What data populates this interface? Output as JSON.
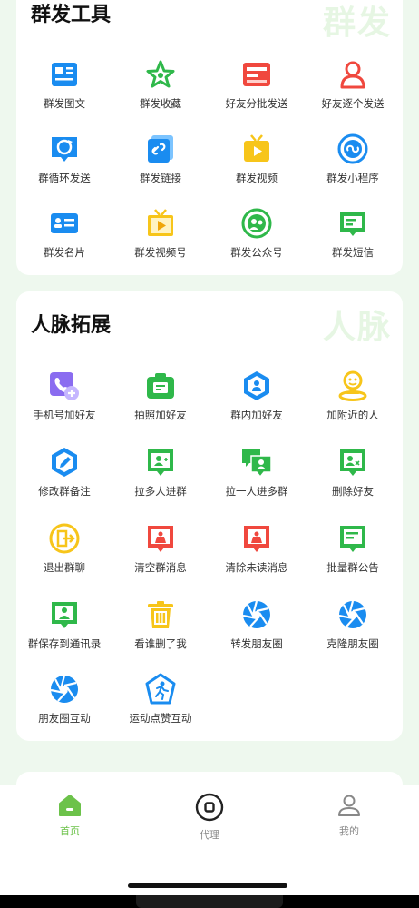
{
  "sections": [
    {
      "title": "群发工具",
      "watermark": "群发",
      "items": [
        {
          "label": "群发图文",
          "icon": "image-text-icon"
        },
        {
          "label": "群发收藏",
          "icon": "star-icon"
        },
        {
          "label": "好友分批发送",
          "icon": "batch-send-icon"
        },
        {
          "label": "好友逐个发送",
          "icon": "person-outline-icon"
        },
        {
          "label": "群循环发送",
          "icon": "cycle-chat-icon"
        },
        {
          "label": "群发链接",
          "icon": "link-icon"
        },
        {
          "label": "群发视频",
          "icon": "video-icon"
        },
        {
          "label": "群发小程序",
          "icon": "mini-program-icon"
        },
        {
          "label": "群发名片",
          "icon": "business-card-icon"
        },
        {
          "label": "群发视频号",
          "icon": "tv-icon"
        },
        {
          "label": "群发公众号",
          "icon": "official-account-icon"
        },
        {
          "label": "群发短信",
          "icon": "sms-icon"
        }
      ]
    },
    {
      "title": "人脉拓展",
      "watermark": "人脉",
      "items": [
        {
          "label": "手机号加好友",
          "icon": "phone-add-icon"
        },
        {
          "label": "拍照加好友",
          "icon": "camera-icon"
        },
        {
          "label": "群内加好友",
          "icon": "group-person-icon"
        },
        {
          "label": "加附近的人",
          "icon": "location-person-icon"
        },
        {
          "label": "修改群备注",
          "icon": "edit-icon"
        },
        {
          "label": "拉多人进群",
          "icon": "add-members-icon"
        },
        {
          "label": "拉一人进多群",
          "icon": "multi-chat-icon"
        },
        {
          "label": "删除好友",
          "icon": "delete-friend-icon"
        },
        {
          "label": "退出群聊",
          "icon": "exit-icon"
        },
        {
          "label": "清空群消息",
          "icon": "clear-group-msg-icon"
        },
        {
          "label": "清除未读消息",
          "icon": "clear-unread-icon"
        },
        {
          "label": "批量群公告",
          "icon": "announcement-icon"
        },
        {
          "label": "群保存到通讯录",
          "icon": "save-contacts-icon"
        },
        {
          "label": "看谁删了我",
          "icon": "trash-icon"
        },
        {
          "label": "转发朋友圈",
          "icon": "moments-forward-icon"
        },
        {
          "label": "克隆朋友圈",
          "icon": "moments-clone-icon"
        },
        {
          "label": "朋友圈互动",
          "icon": "moments-interact-icon"
        },
        {
          "label": "运动点赞互动",
          "icon": "sport-like-icon"
        }
      ]
    }
  ],
  "tabbar": {
    "tabs": [
      {
        "label": "首页",
        "icon": "home-icon",
        "active": true
      },
      {
        "label": "代理",
        "icon": "agent-icon",
        "active": false
      },
      {
        "label": "我的",
        "icon": "profile-icon",
        "active": false
      }
    ]
  },
  "colors": {
    "accent_green": "#6cc24a",
    "blue": "#1a8cf0",
    "red": "#f0483e",
    "yellow": "#f7c51a",
    "purple": "#8a6cf0"
  }
}
